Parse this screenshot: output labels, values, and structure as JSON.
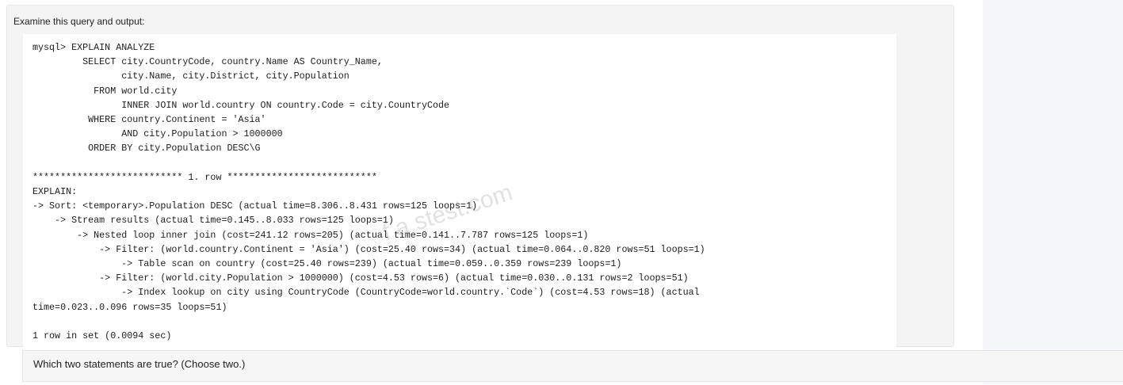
{
  "question": {
    "prompt_label": "Examine this query and output:",
    "code_lines": [
      "mysql> EXPLAIN ANALYZE",
      "         SELECT city.CountryCode, country.Name AS Country_Name,",
      "                city.Name, city.District, city.Population",
      "           FROM world.city",
      "                INNER JOIN world.country ON country.Code = city.CountryCode",
      "          WHERE country.Continent = 'Asia'",
      "                AND city.Population > 1000000",
      "          ORDER BY city.Population DESC\\G",
      "",
      "*************************** 1. row ***************************",
      "EXPLAIN:",
      "-> Sort: <temporary>.Population DESC (actual time=8.306..8.431 rows=125 loops=1)",
      "    -> Stream results (actual time=0.145..8.033 rows=125 loops=1)",
      "        -> Nested loop inner join (cost=241.12 rows=205) (actual time=0.141..7.787 rows=125 loops=1)",
      "            -> Filter: (world.country.Continent = 'Asia') (cost=25.40 rows=34) (actual time=0.064..0.820 rows=51 loops=1)",
      "                -> Table scan on country (cost=25.40 rows=239) (actual time=0.059..0.359 rows=239 loops=1)",
      "            -> Filter: (world.city.Population > 1000000) (cost=4.53 rows=6) (actual time=0.030..0.131 rows=2 loops=51)",
      "                -> Index lookup on city using CountryCode (CountryCode=world.country.`Code`) (cost=4.53 rows=18) (actual",
      "time=0.023..0.096 rows=35 loops=51)",
      "",
      "1 row in set (0.0094 sec)"
    ],
    "watermark": "f a stest.com",
    "question_text": "Which two statements are true? (Choose two.)"
  }
}
